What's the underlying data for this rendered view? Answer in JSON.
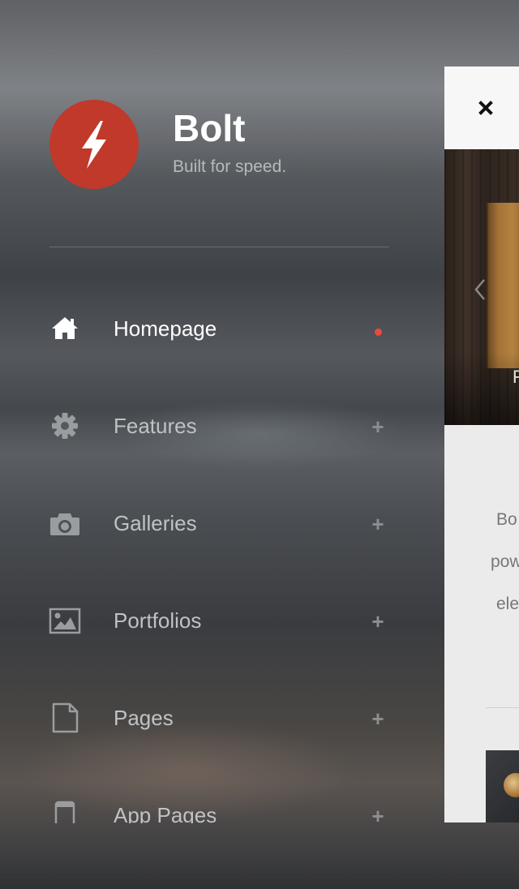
{
  "brand": {
    "name": "Bolt",
    "tagline": "Built for speed.",
    "logo_icon": "lightning-bolt-icon",
    "logo_color": "#c0392b"
  },
  "nav": {
    "active_index": 0,
    "active_indicator_color": "#e74c3c",
    "items": [
      {
        "label": "Homepage",
        "icon": "home-icon",
        "expandable": false,
        "active": true
      },
      {
        "label": "Features",
        "icon": "gear-icon",
        "expandable": true,
        "expand_symbol": "+"
      },
      {
        "label": "Galleries",
        "icon": "camera-icon",
        "expandable": true,
        "expand_symbol": "+"
      },
      {
        "label": "Portfolios",
        "icon": "image-icon",
        "expandable": true,
        "expand_symbol": "+"
      },
      {
        "label": "Pages",
        "icon": "file-icon",
        "expandable": true,
        "expand_symbol": "+"
      },
      {
        "label": "App Pages",
        "icon": "mobile-icon",
        "expandable": true,
        "expand_symbol": "+"
      }
    ]
  },
  "panel": {
    "close_icon": "close-icon",
    "hero": {
      "caption": "F",
      "prev_icon": "chevron-left-icon"
    },
    "intro_lines": [
      "Bo",
      "pow",
      "ele"
    ]
  }
}
